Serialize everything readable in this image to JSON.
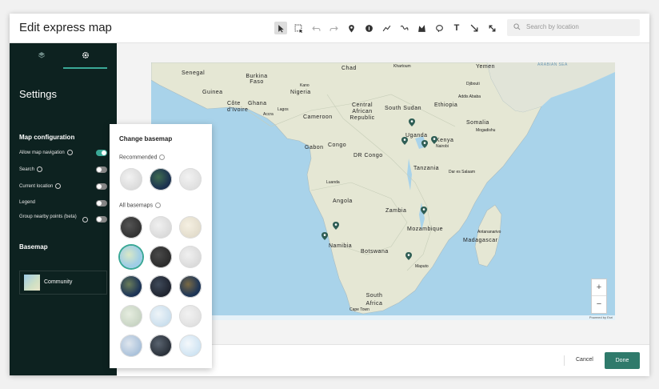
{
  "header": {
    "title": "Edit express map",
    "search_placeholder": "Search by location",
    "text_tool": "T"
  },
  "sidebar": {
    "heading": "Settings",
    "map_config_heading": "Map configuration",
    "options": [
      {
        "label": "Allow map navigation",
        "on": true
      },
      {
        "label": "Search",
        "on": false
      },
      {
        "label": "Current location",
        "on": false
      },
      {
        "label": "Legend",
        "on": false
      },
      {
        "label": "Group nearby points (beta)",
        "on": false
      }
    ],
    "basemap_heading": "Basemap",
    "basemap_name": "Community"
  },
  "basemap_popover": {
    "title": "Change basemap",
    "recommended_label": "Recommended",
    "all_label": "All basemaps"
  },
  "map": {
    "labels": {
      "senegal": "Senegal",
      "burkina": "Burkina Faso",
      "chad": "Chad",
      "khartoum": "Khartoum",
      "yemen": "Yemen",
      "arabian": "ARABIAN SEA",
      "guinea": "Guinea",
      "nigeria": "Nigeria",
      "djibouti": "Djibouti",
      "ivoire": "Côte d'Ivoire",
      "ghana": "Ghana",
      "south_sudan": "South Sudan",
      "ethiopia": "Ethiopia",
      "addis": "Addis Ababa",
      "car": "Central African Republic",
      "kano": "Kano",
      "lagos": "Lagos",
      "accra": "Accra",
      "cameroon": "Cameroon",
      "somalia": "Somalia",
      "mogadishu": "Mogadishu",
      "uganda": "Uganda",
      "kenya": "Kenya",
      "nairobi": "Nairobi",
      "gabon": "Gabon",
      "congo": "Congo",
      "drc": "DR Congo",
      "tanzania": "Tanzania",
      "dar": "Dar es Salaam",
      "luanda": "Luanda",
      "angola": "Angola",
      "zambia": "Zambia",
      "namibia": "Namibia",
      "mozambique": "Mozambique",
      "madagascar": "Madagascar",
      "antananarivo": "Antananarivo",
      "botswana": "Botswana",
      "maputo": "Maputo",
      "south_africa": "South Africa",
      "cape_town": "Cape Town"
    },
    "attribution": "Powered by Esri",
    "zoom_in": "+",
    "zoom_out": "−"
  },
  "footer": {
    "cancel_label": "Cancel",
    "done_label": "Done"
  },
  "colors": {
    "accent": "#3aa896",
    "sidebar_bg": "#0d2220",
    "done_bg": "#2f7a6b",
    "pin": "#2f5e55"
  }
}
